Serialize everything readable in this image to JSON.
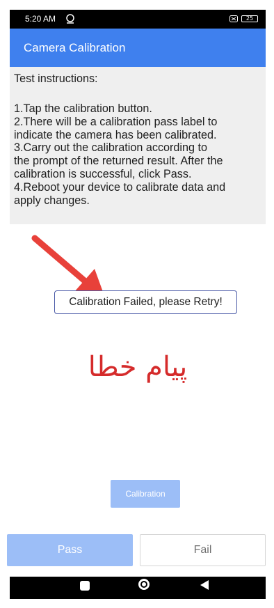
{
  "status_bar": {
    "time": "5:20 AM",
    "battery": "25",
    "icons": [
      "alarm-icon",
      "sim-icon",
      "battery-icon"
    ]
  },
  "app_bar": {
    "title": "Camera Calibration"
  },
  "instructions": {
    "heading": "Test instructions:",
    "lines": [
      "1.Tap the calibration button.",
      "2.There will be a calibration pass label to",
      "indicate the camera has been calibrated.",
      "3.Carry out the calibration according to",
      "the prompt of the returned result. After the",
      "calibration is successful, click Pass.",
      "4.Reboot your device to calibrate data and",
      "apply changes."
    ]
  },
  "annotation": {
    "arrow_color": "#e8413a",
    "persian_text": "پیام خطا",
    "persian_color": "#d52b2b"
  },
  "result": {
    "label": "Calibration Failed, please Retry!"
  },
  "buttons": {
    "calibration": "Calibration",
    "pass": "Pass",
    "fail": "Fail"
  },
  "colors": {
    "app_bar": "#3f80ee",
    "button_disabled": "#9cbef7"
  },
  "nav_bar": {
    "icons": [
      "recents-icon",
      "home-icon",
      "back-icon"
    ]
  }
}
